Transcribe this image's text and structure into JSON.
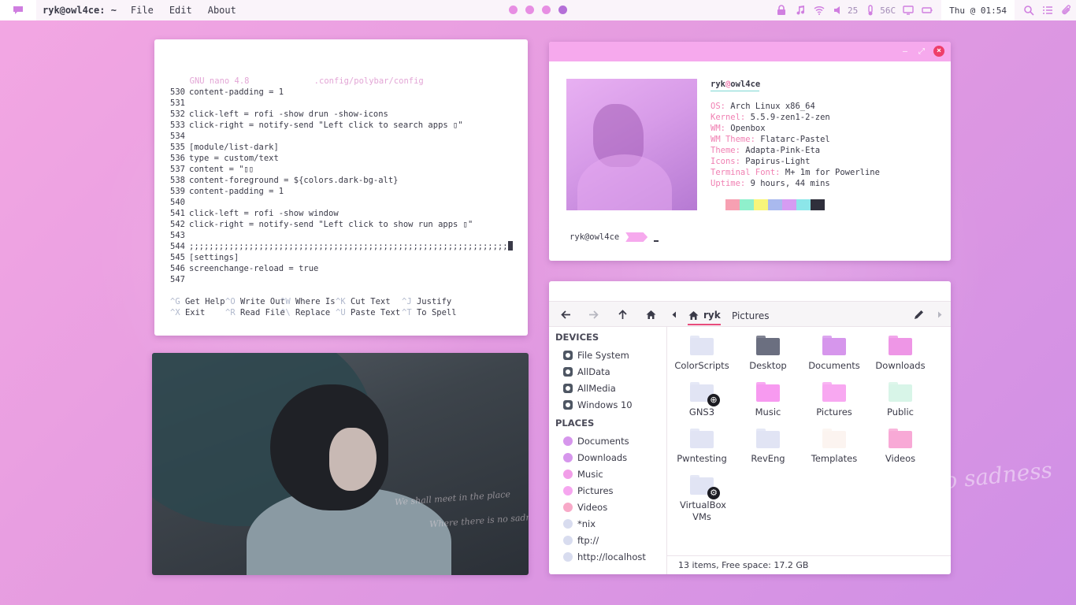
{
  "topbar": {
    "host": "ryk@owl4ce: ~",
    "menu": [
      "File",
      "Edit",
      "About"
    ],
    "volume": "25",
    "temp": "56C",
    "clock": "Thu @ 01:54"
  },
  "nano": {
    "header": "  GNU nano 4.8             .config/polybar/config",
    "lines": [
      {
        "num": "530",
        "text": "content-padding = 1"
      },
      {
        "num": "531",
        "text": ""
      },
      {
        "num": "532",
        "text": "click-left = rofi -show drun -show-icons"
      },
      {
        "num": "533",
        "text": "click-right = notify-send \"Left click to search apps ▯\""
      },
      {
        "num": "534",
        "text": ""
      },
      {
        "num": "535",
        "text": "[module/list-dark]"
      },
      {
        "num": "536",
        "text": "type = custom/text"
      },
      {
        "num": "537",
        "text": "content = \"▯▯"
      },
      {
        "num": "538",
        "text": "content-foreground = ${colors.dark-bg-alt}"
      },
      {
        "num": "539",
        "text": "content-padding = 1"
      },
      {
        "num": "540",
        "text": ""
      },
      {
        "num": "541",
        "text": "click-left = rofi -show window"
      },
      {
        "num": "542",
        "text": "click-right = notify-send \"Left click to show run apps ▯\""
      },
      {
        "num": "543",
        "text": ""
      },
      {
        "num": "544",
        "text": ";;;;;;;;;;;;;;;;;;;;;;;;;;;;;;;;;;;;;;;;;;;;;;;;;;;;;;;;;;;;;;;;"
      },
      {
        "num": "545",
        "text": "[settings]"
      },
      {
        "num": "546",
        "text": "screenchange-reload = true"
      },
      {
        "num": "547",
        "text": ""
      }
    ],
    "help_row1": [
      {
        "key": "^G",
        "label": "Get Help "
      },
      {
        "key": "^O",
        "label": "Write Out "
      },
      {
        "key": "^W",
        "label": "Where Is  "
      },
      {
        "key": "^K",
        "label": "Cut Text  "
      },
      {
        "key": "^J",
        "label": "Justify"
      }
    ],
    "help_row2": [
      {
        "key": "^X",
        "label": "Exit     "
      },
      {
        "key": "^R",
        "label": "Read File "
      },
      {
        "key": "^\\",
        "label": "Replace   "
      },
      {
        "key": "^U",
        "label": "Paste Text"
      },
      {
        "key": "^T",
        "label": "To Spell"
      }
    ]
  },
  "neofetch": {
    "user": "ryk",
    "at": "@",
    "host": "owl4ce",
    "info": [
      {
        "key": "OS: ",
        "value": "Arch Linux x86_64"
      },
      {
        "key": "Kernel: ",
        "value": "5.5.9-zen1-2-zen"
      },
      {
        "key": "WM: ",
        "value": "Openbox"
      },
      {
        "key": "WM Theme: ",
        "value": "Flatarc-Pastel"
      },
      {
        "key": "Theme: ",
        "value": "Adapta-Pink-Eta"
      },
      {
        "key": "Icons: ",
        "value": "Papirus-Light"
      },
      {
        "key": "Terminal Font: ",
        "value": "M+ 1m for Powerline"
      },
      {
        "key": "Uptime: ",
        "value": "9 hours, 44 mins"
      }
    ],
    "palette": [
      "#f7a0b2",
      "#8ff0cc",
      "#f8f57a",
      "#a9b9ee",
      "#d69cf2",
      "#8ce6e9",
      "#2f2f3c"
    ],
    "prompt": "ryk@owl4ce"
  },
  "photo": {
    "text1": "We shall meet in the place",
    "text2": "Where there is no sadness"
  },
  "wall_text": "no sadness",
  "filemanager": {
    "breadcrumb_home": "ryk",
    "breadcrumb_current": "Pictures",
    "devices_header": "DEVICES",
    "devices": [
      "File System",
      "AllData",
      "AllMedia",
      "Windows 10"
    ],
    "places_header": "PLACES",
    "places": [
      {
        "label": "Documents",
        "color": "#d696ec"
      },
      {
        "label": "Downloads",
        "color": "#d696ec"
      },
      {
        "label": "Music",
        "color": "#f19ee8"
      },
      {
        "label": "Pictures",
        "color": "#f6a6ef"
      },
      {
        "label": "Videos",
        "color": "#f8a9c8"
      },
      {
        "label": "*nix",
        "color": "#d8dcef"
      },
      {
        "label": "ftp://",
        "color": "#d8dcef"
      },
      {
        "label": "http://localhost",
        "color": "#d8dcef"
      }
    ],
    "items": [
      {
        "label": "ColorScripts",
        "color": "#e1e4f4",
        "emblem": ""
      },
      {
        "label": "Desktop",
        "color": "#6b6f80",
        "emblem": ""
      },
      {
        "label": "Documents",
        "color": "#d696ec",
        "emblem": ""
      },
      {
        "label": "Downloads",
        "color": "#ee96e6",
        "emblem": ""
      },
      {
        "label": "GNS3",
        "color": "#e1e4f4",
        "emblem": "globe"
      },
      {
        "label": "Music",
        "color": "#f79af0",
        "emblem": ""
      },
      {
        "label": "Pictures",
        "color": "#f8a8f1",
        "emblem": ""
      },
      {
        "label": "Public",
        "color": "#d8f5e8",
        "emblem": ""
      },
      {
        "label": "Pwntesting",
        "color": "#e1e4f4",
        "emblem": ""
      },
      {
        "label": "RevEng",
        "color": "#e1e4f4",
        "emblem": ""
      },
      {
        "label": "Templates",
        "color": "#fcf4f0",
        "emblem": ""
      },
      {
        "label": "Videos",
        "color": "#f8a9d6",
        "emblem": ""
      },
      {
        "label": "VirtualBox VMs",
        "color": "#e1e4f4",
        "emblem": "gear"
      }
    ],
    "status": "13 items, Free space: 17.2 GB"
  }
}
